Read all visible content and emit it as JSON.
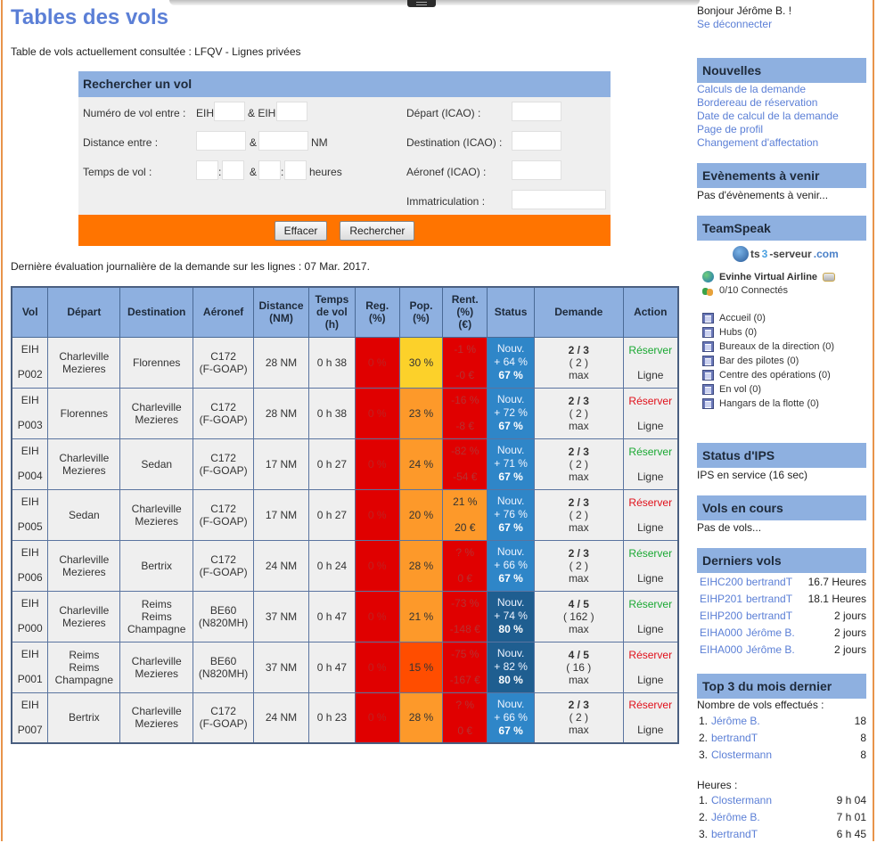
{
  "page": {
    "title": "Tables des vols",
    "subtitle": "Table de vols actuellement consultée : LFQV - Lignes privées",
    "evaluation": "Dernière évaluation journalière de la demande sur les lignes : 07 Mar. 2017."
  },
  "search": {
    "title": "Rechercher un vol",
    "flight_number_label": "Numéro de vol entre :",
    "prefix1": "EIH",
    "and_prefix2": "& EIH",
    "distance_label": "Distance entre :",
    "amp": "&",
    "nm": "NM",
    "time_label": "Temps de vol :",
    "colon": ":",
    "hours": "heures",
    "departure_label": "Départ (ICAO) :",
    "destination_label": "Destination (ICAO) :",
    "aircraft_label": "Aéronef (ICAO) :",
    "registration_label": "Immatriculation :",
    "clear_button": "Effacer",
    "search_button": "Rechercher",
    "values": {
      "flight_from": "",
      "flight_to": "",
      "dist_from": "",
      "dist_to": "",
      "time_h1": "",
      "time_m1": "",
      "time_h2": "",
      "time_m2": "",
      "departure": "",
      "destination": "",
      "aircraft": "",
      "registration": ""
    }
  },
  "table": {
    "headers": {
      "vol": "Vol",
      "depart": "Départ",
      "destination": "Destination",
      "aeronef": "Aéronef",
      "distance": [
        "Distance",
        "(NM)"
      ],
      "temps": [
        "Temps",
        "de vol",
        "(h)"
      ],
      "reg": [
        "Reg.",
        "(%)"
      ],
      "pop": [
        "Pop.",
        "(%)"
      ],
      "rent": [
        "Rent.",
        "(%)",
        "(€)"
      ],
      "status": "Status",
      "demande": "Demande",
      "action": "Action"
    },
    "rows": [
      {
        "prefix": "EIH",
        "code": "P002",
        "dep": [
          "Charleville",
          "Mezieres"
        ],
        "dest": [
          "Florennes"
        ],
        "ac": [
          "C172",
          "(F-GOAP)"
        ],
        "dist": "28 NM",
        "time": "0 h 38",
        "reg": "0 %",
        "pop": "30 %",
        "pop_level": "yellow",
        "rent_pct": "-1 %",
        "rent_eur": "-0 €",
        "rent_level": "red",
        "st1": "Nouv.",
        "st2": "+ 64 %",
        "st3": "67 %",
        "st_level": "blue",
        "dem1": "2 / 3",
        "dem2": "( 2 )",
        "dem3": "max",
        "reserve": "Réserver",
        "reserve_color": "green",
        "line": "Ligne"
      },
      {
        "prefix": "EIH",
        "code": "P003",
        "dep": [
          "Florennes"
        ],
        "dest": [
          "Charleville",
          "Mezieres"
        ],
        "ac": [
          "C172",
          "(F-GOAP)"
        ],
        "dist": "28 NM",
        "time": "0 h 38",
        "reg": "0 %",
        "pop": "23 %",
        "pop_level": "orange",
        "rent_pct": "-16 %",
        "rent_eur": "-8 €",
        "rent_level": "red",
        "st1": "Nouv.",
        "st2": "+ 72 %",
        "st3": "67 %",
        "st_level": "blue",
        "dem1": "2 / 3",
        "dem2": "( 2 )",
        "dem3": "max",
        "reserve": "Réserver",
        "reserve_color": "red",
        "line": "Ligne"
      },
      {
        "prefix": "EIH",
        "code": "P004",
        "dep": [
          "Charleville",
          "Mezieres"
        ],
        "dest": [
          "Sedan"
        ],
        "ac": [
          "C172",
          "(F-GOAP)"
        ],
        "dist": "17 NM",
        "time": "0 h 27",
        "reg": "0 %",
        "pop": "24 %",
        "pop_level": "orange",
        "rent_pct": "-82 %",
        "rent_eur": "-54 €",
        "rent_level": "red",
        "st1": "Nouv.",
        "st2": "+ 71 %",
        "st3": "67 %",
        "st_level": "blue",
        "dem1": "2 / 3",
        "dem2": "( 2 )",
        "dem3": "max",
        "reserve": "Réserver",
        "reserve_color": "green",
        "line": "Ligne"
      },
      {
        "prefix": "EIH",
        "code": "P005",
        "dep": [
          "Sedan"
        ],
        "dest": [
          "Charleville",
          "Mezieres"
        ],
        "ac": [
          "C172",
          "(F-GOAP)"
        ],
        "dist": "17 NM",
        "time": "0 h 27",
        "reg": "0 %",
        "pop": "20 %",
        "pop_level": "orange",
        "rent_pct": "21 %",
        "rent_eur": "20 €",
        "rent_level": "orange",
        "st1": "Nouv.",
        "st2": "+ 76 %",
        "st3": "67 %",
        "st_level": "blue",
        "dem1": "2 / 3",
        "dem2": "( 2 )",
        "dem3": "max",
        "reserve": "Réserver",
        "reserve_color": "red",
        "line": "Ligne"
      },
      {
        "prefix": "EIH",
        "code": "P006",
        "dep": [
          "Charleville",
          "Mezieres"
        ],
        "dest": [
          "Bertrix"
        ],
        "ac": [
          "C172",
          "(F-GOAP)"
        ],
        "dist": "24 NM",
        "time": "0 h 24",
        "reg": "0 %",
        "pop": "28 %",
        "pop_level": "orange",
        "rent_pct": "? %",
        "rent_eur": "0 €",
        "rent_level": "red",
        "st1": "Nouv.",
        "st2": "+ 66 %",
        "st3": "67 %",
        "st_level": "blue",
        "dem1": "2 / 3",
        "dem2": "( 2 )",
        "dem3": "max",
        "reserve": "Réserver",
        "reserve_color": "green",
        "line": "Ligne"
      },
      {
        "prefix": "EIH",
        "code": "P000",
        "dep": [
          "Charleville",
          "Mezieres"
        ],
        "dest": [
          "Reims",
          "Reims",
          "Champagne"
        ],
        "ac": [
          "BE60",
          "(N820MH)"
        ],
        "dist": "37 NM",
        "time": "0 h 47",
        "reg": "0 %",
        "pop": "21 %",
        "pop_level": "orange",
        "rent_pct": "-73 %",
        "rent_eur": "-148 €",
        "rent_level": "red",
        "st1": "Nouv.",
        "st2": "+ 74 %",
        "st3": "80 %",
        "st_level": "dark",
        "dem1": "4 / 5",
        "dem2": "( 162 )",
        "dem3": "max",
        "reserve": "Réserver",
        "reserve_color": "green",
        "line": "Ligne"
      },
      {
        "prefix": "EIH",
        "code": "P001",
        "dep": [
          "Reims",
          "Reims",
          "Champagne"
        ],
        "dest": [
          "Charleville",
          "Mezieres"
        ],
        "ac": [
          "BE60",
          "(N820MH)"
        ],
        "dist": "37 NM",
        "time": "0 h 47",
        "reg": "0 %",
        "pop": "15 %",
        "pop_level": "orangered",
        "rent_pct": "-75 %",
        "rent_eur": "-167 €",
        "rent_level": "red",
        "st1": "Nouv.",
        "st2": "+ 82 %",
        "st3": "80 %",
        "st_level": "dark",
        "dem1": "4 / 5",
        "dem2": "( 16 )",
        "dem3": "max",
        "reserve": "Réserver",
        "reserve_color": "red",
        "line": "Ligne"
      },
      {
        "prefix": "EIH",
        "code": "P007",
        "dep": [
          "Bertrix"
        ],
        "dest": [
          "Charleville",
          "Mezieres"
        ],
        "ac": [
          "C172",
          "(F-GOAP)"
        ],
        "dist": "24 NM",
        "time": "0 h 23",
        "reg": "0 %",
        "pop": "28 %",
        "pop_level": "orange",
        "rent_pct": "? %",
        "rent_eur": "0 €",
        "rent_level": "red",
        "st1": "Nouv.",
        "st2": "+ 66 %",
        "st3": "67 %",
        "st_level": "blue",
        "dem1": "2 / 3",
        "dem2": "( 2 )",
        "dem3": "max",
        "reserve": "Réserver",
        "reserve_color": "red",
        "line": "Ligne"
      }
    ]
  },
  "sidebar": {
    "greeting": "Bonjour Jérôme B. !",
    "logout": "Se déconnecter",
    "news": {
      "title": "Nouvelles",
      "items": [
        "Calculs de la demande",
        "Bordereau de réservation",
        "Date de calcul de la demande",
        "Page de profil",
        "Changement d'affectation"
      ]
    },
    "events": {
      "title": "Evènements à venir",
      "text": "Pas d'évènements à venir..."
    },
    "teamspeak": {
      "title": "TeamSpeak",
      "logo_ts": "ts",
      "logo_3": "3",
      "logo_serveur": "-serveur",
      "logo_com": ".com",
      "server": "Evinhe Virtual Airline",
      "connected": "0/10 Connectés",
      "channels": [
        "Accueil (0)",
        "Hubs (0)",
        "Bureaux de la direction (0)",
        "Bar des pilotes (0)",
        "Centre des opérations (0)",
        "En vol (0)",
        "Hangars de la flotte (0)"
      ]
    },
    "ips": {
      "title": "Status d'IPS",
      "text": "IPS en service (16 sec)"
    },
    "current": {
      "title": "Vols en cours",
      "text": "Pas de vols..."
    },
    "recent": {
      "title": "Derniers vols",
      "rows": [
        {
          "code": "EIHC200",
          "who": "bertrandT",
          "when": "16.7 Heures"
        },
        {
          "code": "EIHP201",
          "who": "bertrandT",
          "when": "18.1 Heures"
        },
        {
          "code": "EIHP200",
          "who": "bertrandT",
          "when": "2 jours"
        },
        {
          "code": "EIHA000",
          "who": "Jérôme B.",
          "when": "2 jours"
        },
        {
          "code": "EIHA000",
          "who": "Jérôme B.",
          "when": "2 jours"
        }
      ]
    },
    "top3": {
      "title": "Top 3 du mois dernier",
      "flights_label": "Nombre de vols effectués :",
      "flights": [
        {
          "rank": "1.",
          "name": "Jérôme B.",
          "value": "18"
        },
        {
          "rank": "2.",
          "name": "bertrandT",
          "value": "8"
        },
        {
          "rank": "3.",
          "name": "Clostermann",
          "value": "8"
        }
      ],
      "hours_label": "Heures :",
      "hours": [
        {
          "rank": "1.",
          "name": "Clostermann",
          "value": "9 h 04"
        },
        {
          "rank": "2.",
          "name": "Jérôme B.",
          "value": "7 h 01"
        },
        {
          "rank": "3.",
          "name": "bertrandT",
          "value": "6 h 45"
        }
      ]
    }
  }
}
